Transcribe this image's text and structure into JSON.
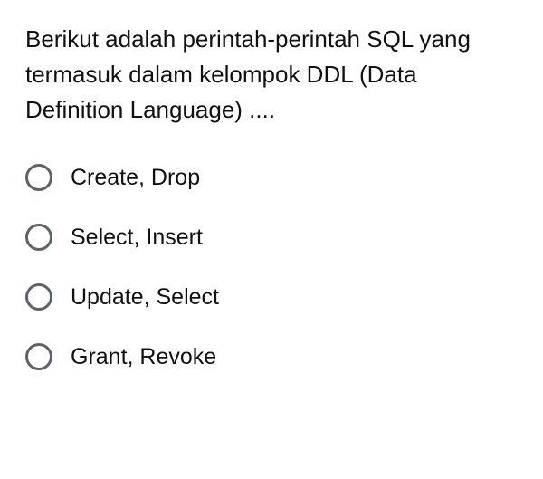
{
  "question": {
    "text": "Berikut adalah perintah-perintah SQL yang termasuk dalam kelompok DDL (Data Definition Language) ...."
  },
  "options": [
    {
      "label": "Create, Drop"
    },
    {
      "label": "Select, Insert"
    },
    {
      "label": "Update, Select"
    },
    {
      "label": "Grant, Revoke"
    }
  ]
}
